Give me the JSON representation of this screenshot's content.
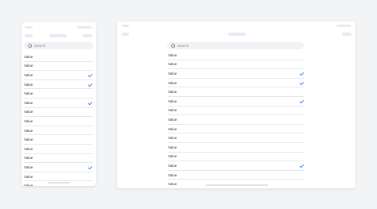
{
  "phone": {
    "search": {
      "placeholder": "Search"
    },
    "items": [
      {
        "label": "Value",
        "checked": false
      },
      {
        "label": "Value",
        "checked": false
      },
      {
        "label": "Value",
        "checked": true
      },
      {
        "label": "Value",
        "checked": true
      },
      {
        "label": "Value",
        "checked": false
      },
      {
        "label": "Value",
        "checked": true
      },
      {
        "label": "Value",
        "checked": false
      },
      {
        "label": "Value",
        "checked": false
      },
      {
        "label": "Value",
        "checked": false
      },
      {
        "label": "Value",
        "checked": false
      },
      {
        "label": "Value",
        "checked": false
      },
      {
        "label": "Value",
        "checked": false
      },
      {
        "label": "Value",
        "checked": true
      },
      {
        "label": "Value",
        "checked": false
      },
      {
        "label": "Value",
        "checked": false
      }
    ]
  },
  "tablet": {
    "search": {
      "placeholder": "Search"
    },
    "items": [
      {
        "label": "Value",
        "checked": false
      },
      {
        "label": "Value",
        "checked": false
      },
      {
        "label": "Value",
        "checked": true
      },
      {
        "label": "Value",
        "checked": true
      },
      {
        "label": "Value",
        "checked": false
      },
      {
        "label": "Value",
        "checked": true
      },
      {
        "label": "Value",
        "checked": false
      },
      {
        "label": "Value",
        "checked": false
      },
      {
        "label": "Value",
        "checked": false
      },
      {
        "label": "Value",
        "checked": false
      },
      {
        "label": "Value",
        "checked": false
      },
      {
        "label": "Value",
        "checked": false
      },
      {
        "label": "Value",
        "checked": true
      },
      {
        "label": "Value",
        "checked": false
      },
      {
        "label": "Value",
        "checked": false
      }
    ]
  },
  "colors": {
    "background": "#f3f4f6",
    "check": "#3b82f6",
    "surface": "#ffffff"
  }
}
